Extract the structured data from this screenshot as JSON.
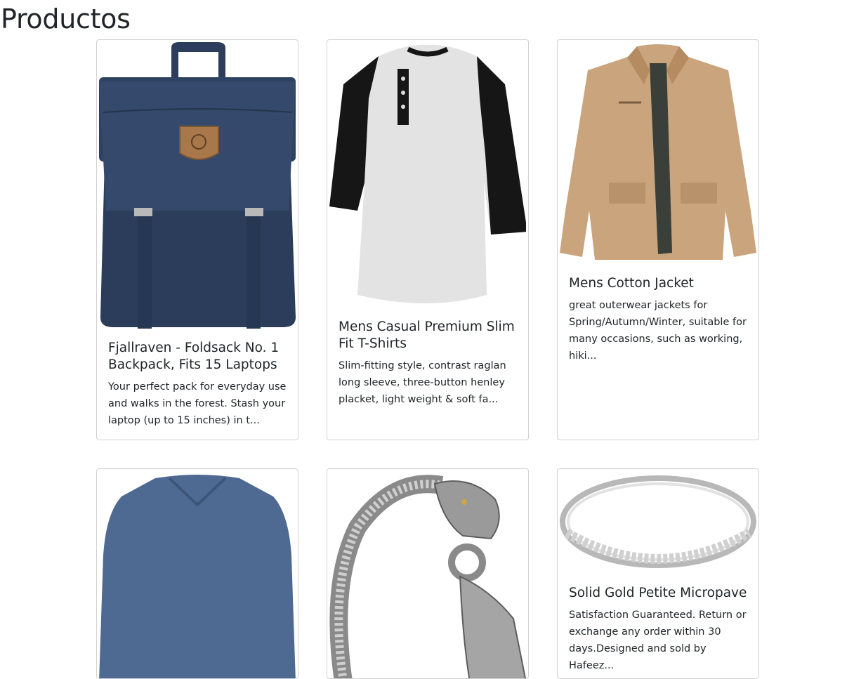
{
  "page": {
    "title": "Productos"
  },
  "products": [
    {
      "title": "Fjallraven - Foldsack No. 1 Backpack, Fits 15 Laptops",
      "description": "Your perfect pack for everyday use and walks in the forest. Stash your laptop (up to 15 inches) in t...",
      "image": "backpack-image"
    },
    {
      "title": "Mens Casual Premium Slim Fit T-Shirts",
      "description": "Slim-fitting style, contrast raglan long sleeve, three-button henley placket, light weight & soft fa...",
      "image": "tshirt-image"
    },
    {
      "title": "Mens Cotton Jacket",
      "description": "great outerwear jackets for Spring/Autumn/Winter, suitable for many occasions, such as working, hiki...",
      "image": "jacket-image"
    },
    {
      "title": "",
      "description": "",
      "image": "long-sleeve-shirt-image"
    },
    {
      "title": "",
      "description": "",
      "image": "dragon-bracelet-image"
    },
    {
      "title": "Solid Gold Petite Micropave",
      "description": "Satisfaction Guaranteed. Return or exchange any order within 30 days.Designed and sold by Hafeez...",
      "image": "ring-image"
    }
  ]
}
